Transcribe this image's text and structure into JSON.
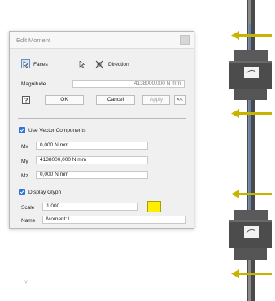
{
  "dialog": {
    "title": "Edit Moment",
    "faces_label": "Faces",
    "direction_label": "Direction",
    "magnitude_label": "Magnitude",
    "magnitude_value": "4138000,000 N mm",
    "ok_label": "OK",
    "cancel_label": "Cancel",
    "apply_label": "Apply",
    "expand_label": "<<",
    "use_vector_components_label": "Use Vector Components",
    "mx_label": "Mx",
    "mx_value": "0,000 N mm",
    "my_label": "My",
    "my_value": "4138000,000 N mm",
    "mz_label": "Mz",
    "mz_value": "0,000 N mm",
    "display_glyph_label": "Display Glyph",
    "scale_label": "Scale",
    "scale_value": "1,000",
    "name_label": "Name",
    "name_value": "Moment:1",
    "glyph_color": "#ffee00"
  },
  "viewport": {
    "arrow_color": "#c7b300",
    "shaft_color": "#5f5f5f",
    "accent_color": "#3a7bd5",
    "axis_marker": "Y"
  }
}
